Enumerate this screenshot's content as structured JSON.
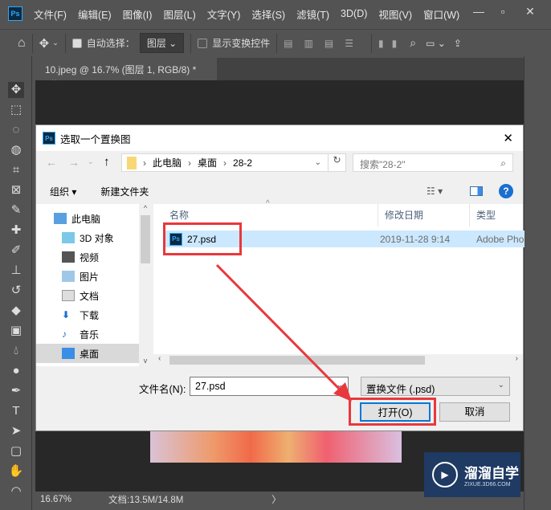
{
  "app": {
    "logo": "Ps",
    "menu": [
      "文件(F)",
      "编辑(E)",
      "图像(I)",
      "图层(L)",
      "文字(Y)",
      "选择(S)",
      "滤镜(T)",
      "3D(D)",
      "视图(V)",
      "窗口(W)"
    ]
  },
  "options": {
    "auto_select_label": "自动选择：",
    "auto_select_value": "图层",
    "show_transform_label": "显示变换控件"
  },
  "document_tab": {
    "title": "10.jpeg @ 16.7% (图层 1, RGB/8) *",
    "close": "×"
  },
  "status": {
    "zoom": "16.67%",
    "doc_size": "文档:13.5M/14.8M"
  },
  "dialog": {
    "title": "选取一个置换图",
    "breadcrumb": [
      "此电脑",
      "桌面",
      "28-2"
    ],
    "search_placeholder": "搜索\"28-2\"",
    "organize": "组织 ▾",
    "new_folder": "新建文件夹",
    "nav_items": [
      "此电脑",
      "3D 对象",
      "视频",
      "图片",
      "文档",
      "下载",
      "音乐",
      "桌面"
    ],
    "columns": [
      "名称",
      "修改日期",
      "类型"
    ],
    "files": [
      {
        "name": "27.psd",
        "modified": "2019-11-28 9:14",
        "type": "Adobe Pho"
      }
    ],
    "filename_label": "文件名(N):",
    "filename_value": "27.psd",
    "filetype": "置换文件 (.psd)",
    "open_button": "打开(O)",
    "cancel_button": "取消"
  },
  "watermark": {
    "name": "溜溜自学",
    "url": "ZIXUE.3D66.COM"
  },
  "colors": {
    "highlight": "#e8383d",
    "selection": "#cce8ff"
  }
}
